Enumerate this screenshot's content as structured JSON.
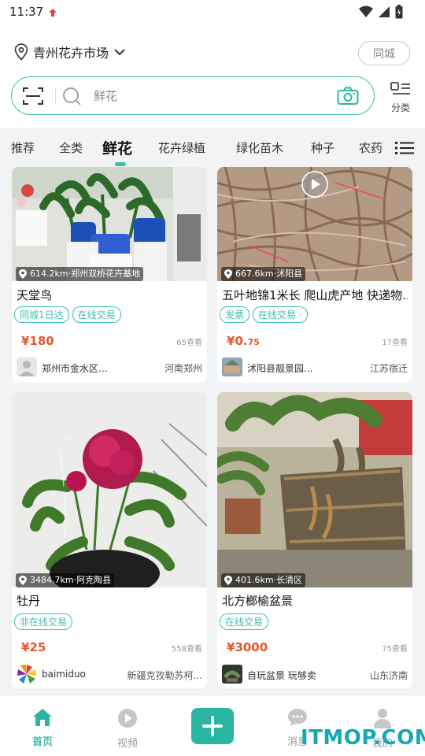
{
  "status_bar": {
    "time": "11:37"
  },
  "header": {
    "location": "青州花卉市场",
    "city_button": "同城"
  },
  "search": {
    "placeholder": "鲜花",
    "category_label": "分类"
  },
  "tabs": [
    {
      "label": "推荐",
      "active": false
    },
    {
      "label": "全类",
      "active": false
    },
    {
      "label": "鲜花",
      "active": true
    },
    {
      "label": "花卉绿植",
      "active": false
    },
    {
      "label": "绿化苗木",
      "active": false
    },
    {
      "label": "种子",
      "active": false
    },
    {
      "label": "农药",
      "active": false
    }
  ],
  "listings": [
    {
      "location_badge": "614.2km·郑州双桥花卉基地",
      "title": "天堂鸟",
      "tags": [
        "同城1日达",
        "在线交易"
      ],
      "price_symbol": "¥",
      "price": "180",
      "views": "65查看",
      "seller": "郑州市金水区...",
      "region": "河南郑州"
    },
    {
      "location_badge": "667.6km·沭阳县",
      "title": "五叶地锦1米长 爬山虎产地 快递物...",
      "tags": [
        "发票",
        "在线交易 ·"
      ],
      "price_symbol": "¥",
      "price": "0.",
      "price_small": "75",
      "views": "17查看",
      "seller": "沭阳县靓景园...",
      "region": "江苏宿迁"
    },
    {
      "location_badge": "3484.7km·阿克陶县",
      "title": "牡丹",
      "tags": [
        "非在线交易"
      ],
      "price_symbol": "¥",
      "price": "25",
      "views": "558查看",
      "seller": "baimiduo",
      "region": "新疆克孜勒苏柯..."
    },
    {
      "location_badge": "401.6km·长清区",
      "title": "北方榔榆盆景",
      "tags": [
        "在线交易"
      ],
      "price_symbol": "¥",
      "price": "3000",
      "views": "75查看",
      "seller": "自玩盆景 玩够卖",
      "region": "山东济南"
    }
  ],
  "bottom_nav": [
    {
      "label": "首页",
      "icon": "home-icon",
      "active": true
    },
    {
      "label": "视频",
      "icon": "video-icon",
      "active": false
    },
    {
      "label": "消息",
      "icon": "message-icon",
      "active": false
    },
    {
      "label": "我的",
      "icon": "user-icon",
      "active": false
    }
  ],
  "watermark": "ITMOP.COM",
  "colors": {
    "accent": "#3cbfae",
    "price": "#e5582b"
  }
}
